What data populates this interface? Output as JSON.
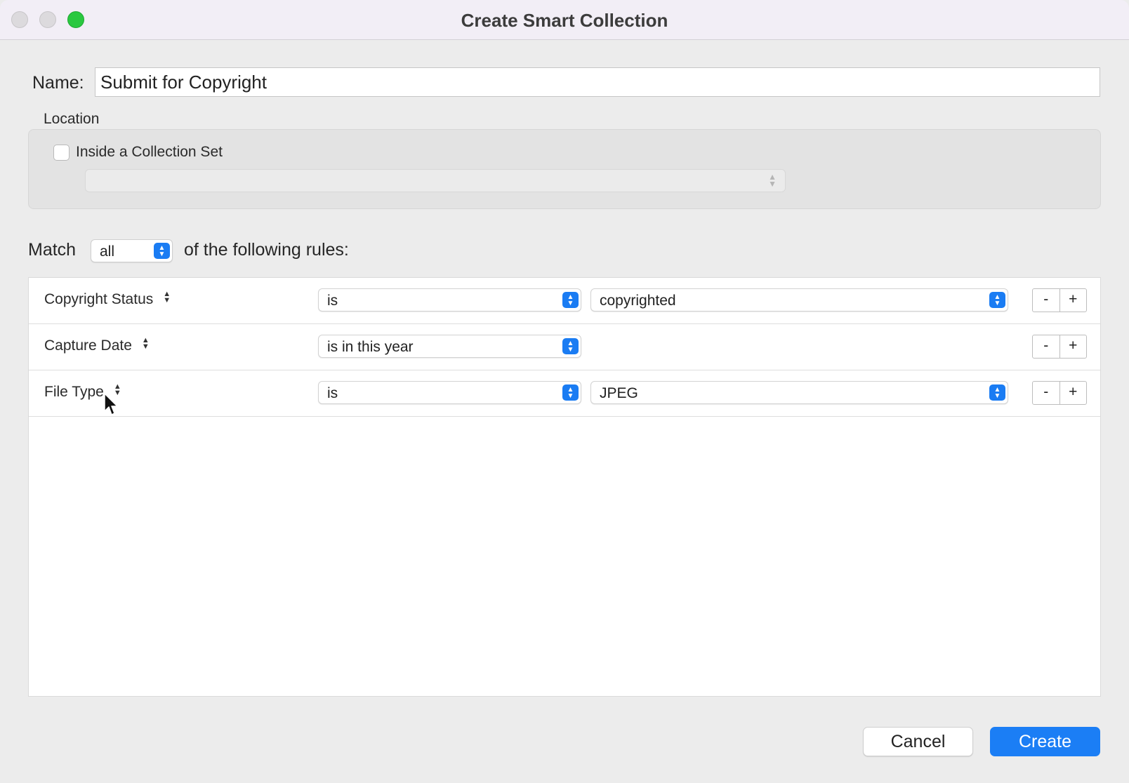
{
  "window": {
    "title": "Create Smart Collection"
  },
  "name": {
    "label": "Name:",
    "value": "Submit for Copyright"
  },
  "location": {
    "label": "Location",
    "checkbox_label": "Inside a Collection Set",
    "checked": false,
    "collection_set_value": ""
  },
  "match": {
    "prefix": "Match",
    "value": "all",
    "suffix": "of the following rules:"
  },
  "rules": [
    {
      "field": "Copyright Status",
      "operator": "is",
      "value": "copyrighted"
    },
    {
      "field": "Capture Date",
      "operator": "is in this year",
      "value": ""
    },
    {
      "field": "File Type",
      "operator": "is",
      "value": "JPEG"
    }
  ],
  "row_buttons": {
    "minus": "-",
    "plus": "+"
  },
  "footer": {
    "cancel": "Cancel",
    "create": "Create"
  },
  "colors": {
    "accent": "#1b7ef5",
    "zoom_button": "#2ac840"
  }
}
